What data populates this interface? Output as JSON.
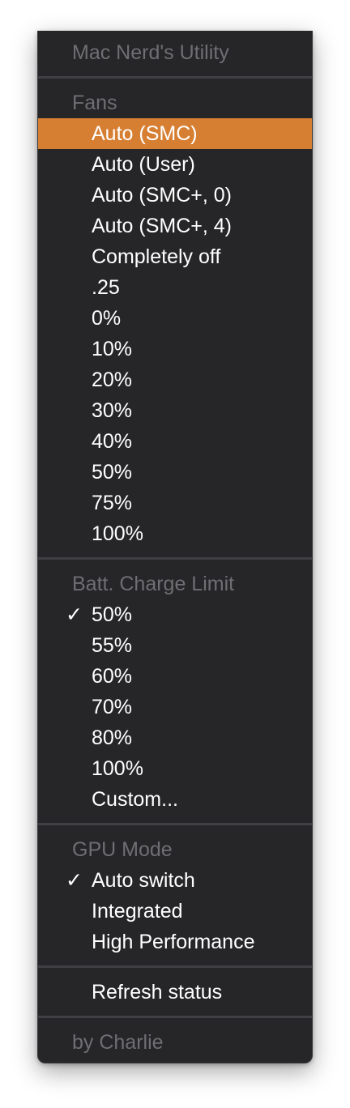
{
  "menu": {
    "app_title": "Mac Nerd's Utility",
    "fans": {
      "header": "Fans",
      "items": [
        "Auto (SMC)",
        "Auto (User)",
        "Auto (SMC+, 0)",
        "Auto (SMC+, 4)",
        "Completely off",
        ".25",
        "0%",
        "10%",
        "20%",
        "30%",
        "40%",
        "50%",
        "75%",
        "100%"
      ],
      "highlighted": "Auto (SMC)"
    },
    "battery": {
      "header": "Batt. Charge Limit",
      "items": [
        "50%",
        "55%",
        "60%",
        "70%",
        "80%",
        "100%",
        "Custom..."
      ],
      "checked": "50%"
    },
    "gpu": {
      "header": "GPU Mode",
      "items": [
        "Auto switch",
        "Integrated",
        "High Performance"
      ],
      "checked": "Auto switch"
    },
    "refresh_label": "Refresh status",
    "footer": "by Charlie",
    "check_glyph": "✓",
    "colors": {
      "highlight": "#d67f32",
      "background": "#262628",
      "disabled_text": "#6f6f73"
    }
  }
}
